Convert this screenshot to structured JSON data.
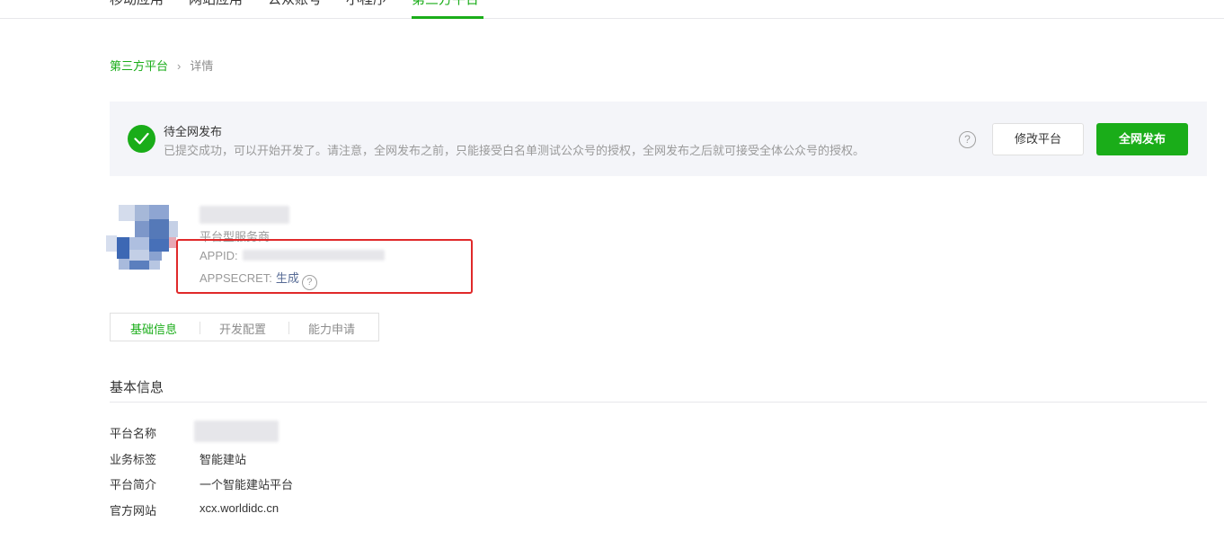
{
  "nav": {
    "tabs": [
      {
        "label": "移动应用"
      },
      {
        "label": "网站应用"
      },
      {
        "label": "公众账号"
      },
      {
        "label": "小程序"
      },
      {
        "label": "第三方平台",
        "active": true
      }
    ]
  },
  "breadcrumb": {
    "parent": "第三方平台",
    "separator": "›",
    "current": "详情"
  },
  "banner": {
    "title": "待全网发布",
    "description": "已提交成功，可以开始开发了。请注意，全网发布之前，只能接受白名单测试公众号的授权，全网发布之后就可接受全体公众号的授权。",
    "help_icon": "?",
    "edit_label": "修改平台",
    "publish_label": "全网发布"
  },
  "platform": {
    "type": "平台型服务商",
    "appid_label": "APPID:",
    "appsecret_label": "APPSECRET:",
    "generate_label": "生成",
    "help_icon": "?"
  },
  "subtabs": [
    {
      "label": "基础信息",
      "active": true
    },
    {
      "label": "开发配置"
    },
    {
      "label": "能力申请"
    }
  ],
  "basic_info": {
    "title": "基本信息",
    "rows": [
      {
        "key": "平台名称",
        "value": ""
      },
      {
        "key": "业务标签",
        "value": "智能建站"
      },
      {
        "key": "平台简介",
        "value": "一个智能建站平台"
      },
      {
        "key": "官方网站",
        "value": "xcx.worldidc.cn"
      }
    ]
  },
  "colors": {
    "accent": "#1aad19",
    "highlight_box": "#e0292a",
    "link": "#576b95"
  }
}
